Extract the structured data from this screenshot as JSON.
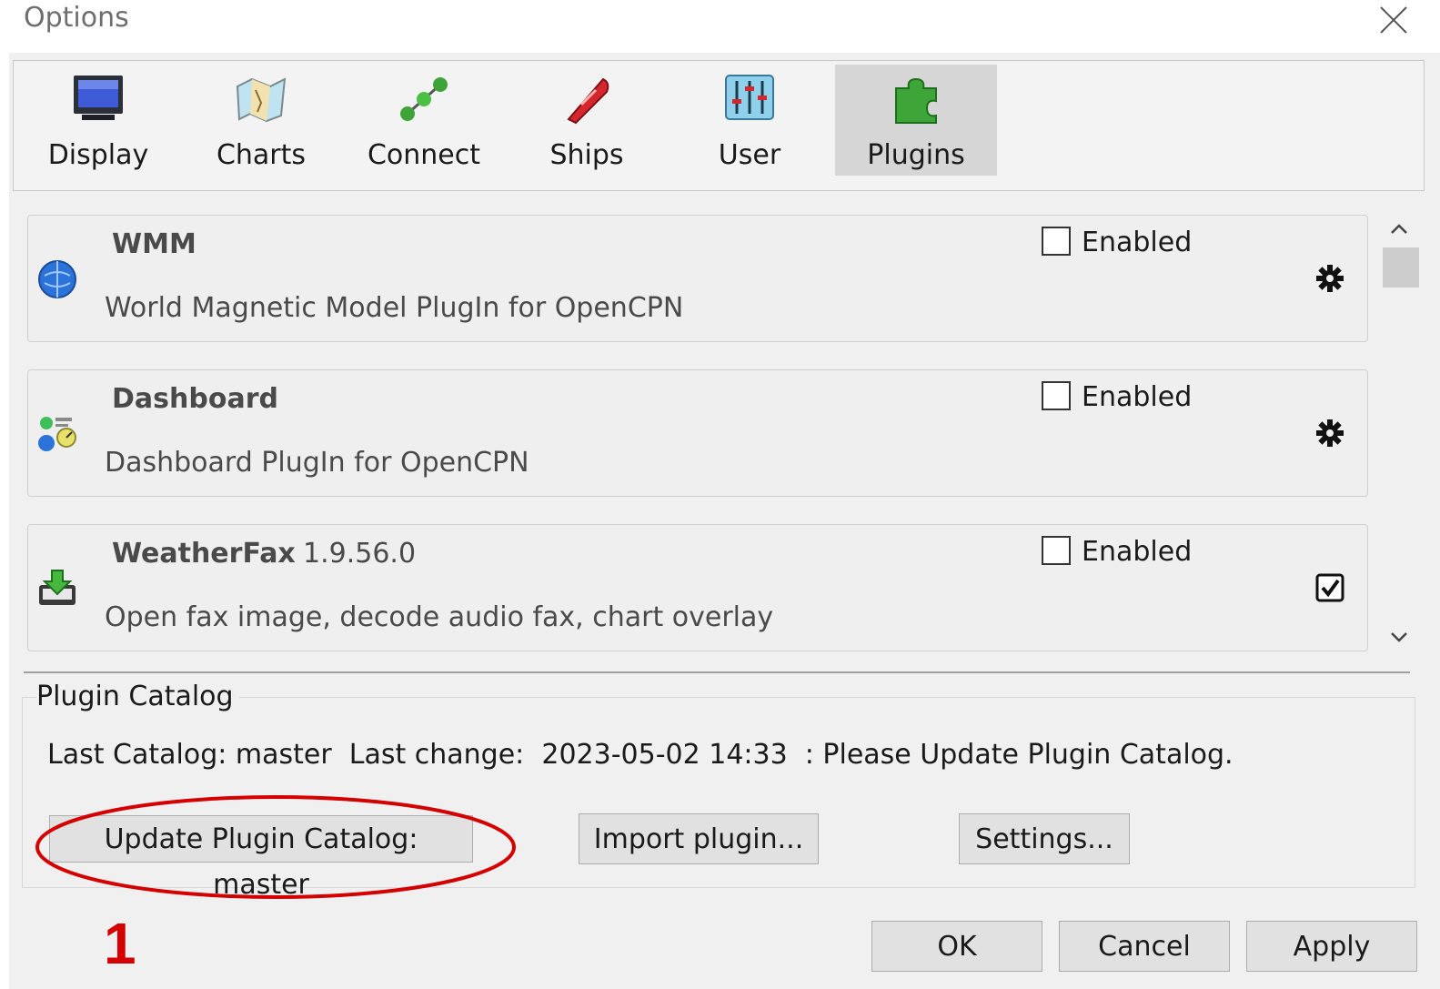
{
  "window": {
    "title": "Options",
    "close_icon": "close-icon"
  },
  "tabs": [
    {
      "label": "Display",
      "icon": "monitor-icon",
      "active": false
    },
    {
      "label": "Charts",
      "icon": "chart-map-icon",
      "active": false
    },
    {
      "label": "Connect",
      "icon": "connection-nodes-icon",
      "active": false
    },
    {
      "label": "Ships",
      "icon": "ship-icon",
      "active": false
    },
    {
      "label": "User",
      "icon": "sliders-icon",
      "active": false
    },
    {
      "label": "Plugins",
      "icon": "puzzle-piece-icon",
      "active": true
    }
  ],
  "plugins": [
    {
      "name": "WMM",
      "version": "",
      "description": "World Magnetic Model PlugIn for OpenCPN",
      "enabled_label": "Enabled",
      "enabled": false,
      "icon": "globe-icon",
      "action_icon": "gear-icon"
    },
    {
      "name": "Dashboard",
      "version": "",
      "description": "Dashboard PlugIn for OpenCPN",
      "enabled_label": "Enabled",
      "enabled": false,
      "icon": "dashboard-icon",
      "action_icon": "gear-icon"
    },
    {
      "name": "WeatherFax",
      "version": "1.9.56.0",
      "description": "Open fax image, decode audio fax, chart overlay",
      "enabled_label": "Enabled",
      "enabled": false,
      "icon": "download-tray-icon",
      "action_icon": "checked-box-icon"
    }
  ],
  "catalog": {
    "title": "Plugin Catalog",
    "status": "Last Catalog: master  Last change:  2023-05-02 14:33  : Please Update Plugin Catalog.",
    "update_button": "Update Plugin Catalog: master",
    "import_button": "Import plugin...",
    "settings_button": "Settings..."
  },
  "footer": {
    "ok": "OK",
    "cancel": "Cancel",
    "apply": "Apply"
  },
  "annotation": {
    "step": "1",
    "color": "#d40000"
  },
  "colors": {
    "active_tab": "#d6d6d6",
    "dialog_bg": "#f0f0f0",
    "button_bg": "#e1e1e1"
  }
}
